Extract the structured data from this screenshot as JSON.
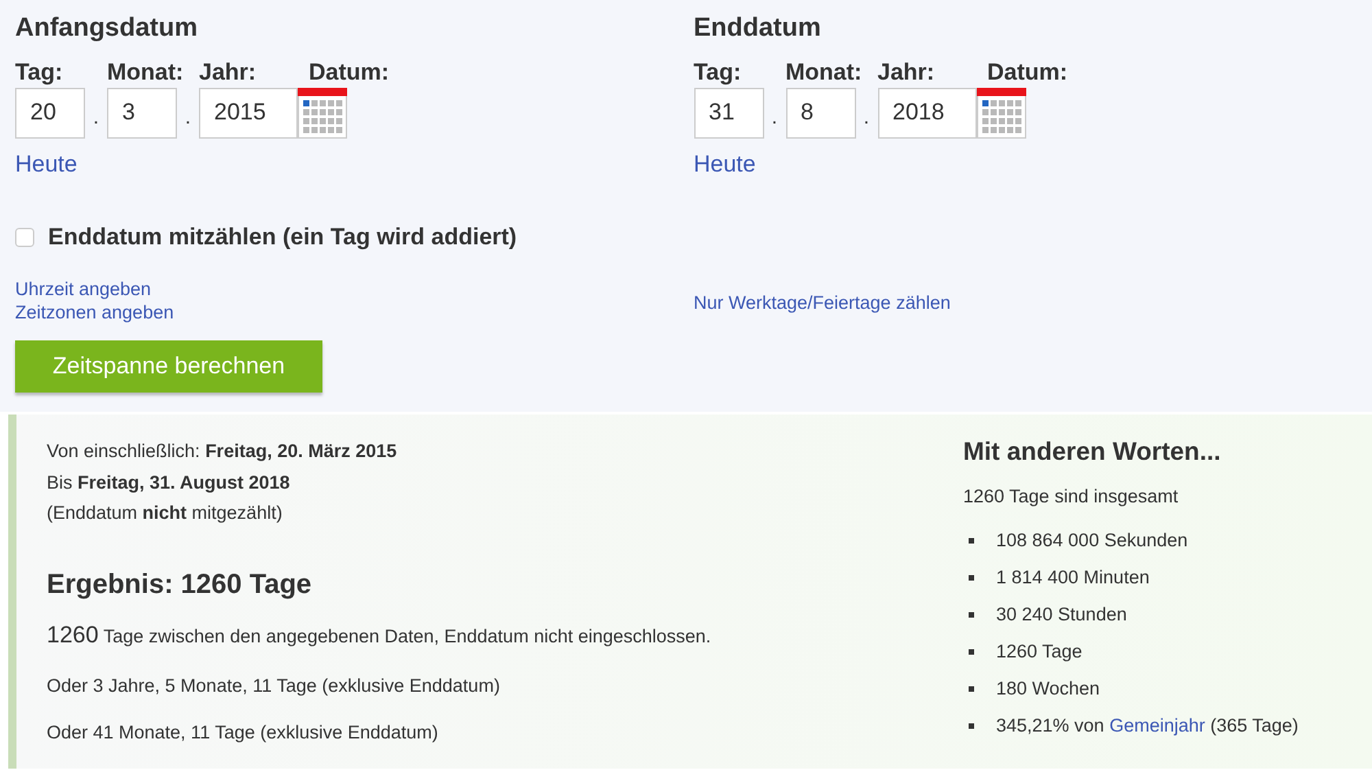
{
  "start": {
    "heading": "Anfangsdatum",
    "labels": [
      "Tag:",
      "Monat:",
      "Jahr:",
      "Datum:"
    ],
    "day": "20",
    "month": "3",
    "year": "2015",
    "separators": [
      ".",
      "."
    ],
    "today_link": "Heute"
  },
  "end": {
    "heading": "Enddatum",
    "labels": [
      "Tag:",
      "Monat:",
      "Jahr:",
      "Datum:"
    ],
    "day": "31",
    "month": "8",
    "year": "2018",
    "separators": [
      ".",
      "."
    ],
    "today_link": "Heute"
  },
  "include_end": {
    "label": "Enddatum mitzählen (ein Tag wird addiert)",
    "checked": false
  },
  "links_left": [
    "Uhrzeit angeben",
    "Zeitzonen angeben"
  ],
  "links_right": [
    "Nur Werktage/Feiertage zählen"
  ],
  "calculate_button": "Zeitspanne berechnen",
  "result": {
    "lines": [
      "Von einschließlich: **Freitag, 20. März 2015**",
      "Bis **Freitag, 31. August 2018**",
      "(Enddatum **nicht** mitgezählt)"
    ],
    "heading": "Ergebnis: 1260 Tage",
    "summary": {
      "count": "1260",
      "text": "Tage zwischen den angegebenen Daten, Enddatum nicht eingeschlossen."
    },
    "alternatives": [
      "Oder 3 Jahre, 5 Monate, 11 Tage (exklusive Enddatum)",
      "Oder 41 Monate, 11 Tage (exklusive Enddatum)"
    ]
  },
  "other_words": {
    "heading": "Mit anderen Worten...",
    "intro": "1260 Tage sind insgesamt",
    "items": [
      {
        "kind": "text",
        "text": "108 864 000 Sekunden"
      },
      {
        "kind": "text",
        "text": "1 814 400 Minuten"
      },
      {
        "kind": "text",
        "text": "30 240 Stunden"
      },
      {
        "kind": "text",
        "text": "1260 Tage"
      },
      {
        "kind": "text",
        "text": "180 Wochen"
      },
      {
        "kind": "link",
        "before": "345,21% von",
        "link": "Gemeinjahr",
        "after": "(365 Tage)"
      }
    ]
  }
}
